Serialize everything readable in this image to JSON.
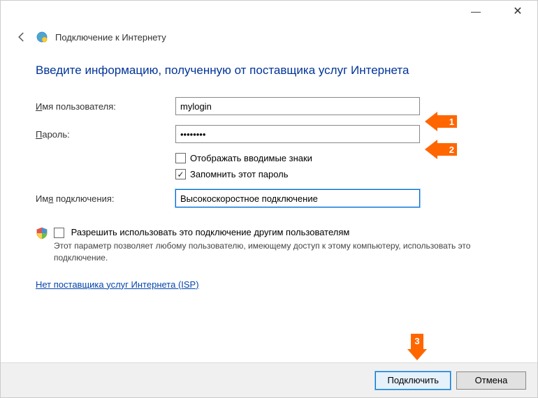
{
  "titlebar": {
    "minimize": "—",
    "close": "✕"
  },
  "header": {
    "title": "Подключение к Интернету"
  },
  "heading": "Введите информацию, полученную от поставщика услуг Интернета",
  "form": {
    "username_label": "Имя пользователя:",
    "username_value": "mylogin",
    "password_label": "Пароль:",
    "password_value": "••••••••",
    "show_chars_label": "Отображать вводимые знаки",
    "remember_label": "Запомнить этот пароль",
    "connection_name_label": "Имя подключения:",
    "connection_name_value": "Высокоскоростное подключение"
  },
  "share": {
    "label": "Разрешить использовать это подключение другим пользователям",
    "sub": "Этот параметр позволяет любому пользователю, имеющему доступ к этому компьютеру, использовать это подключение."
  },
  "no_isp_link": "Нет поставщика услуг Интернета (ISP)",
  "footer": {
    "connect": "Подключить",
    "cancel": "Отмена"
  },
  "callouts": {
    "c1": "1",
    "c2": "2",
    "c3": "3"
  }
}
